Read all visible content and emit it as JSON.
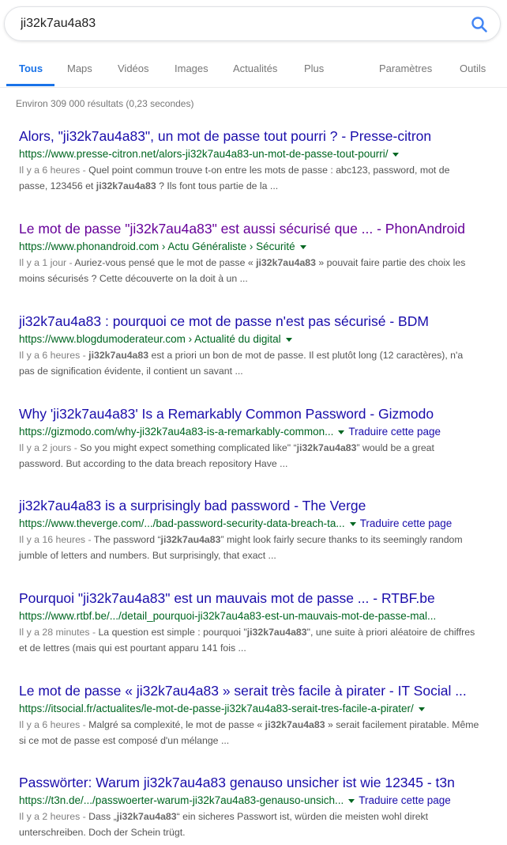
{
  "search": {
    "query": "ji32k7au4a83",
    "icon": "search-icon"
  },
  "tabs": [
    "Tous",
    "Maps",
    "Vidéos",
    "Images",
    "Actualités",
    "Plus"
  ],
  "tools": {
    "settings": "Paramètres",
    "tools": "Outils"
  },
  "stats": "Environ 309 000 résultats (0,23 secondes)",
  "colors": {
    "title": "#1a0dab",
    "visited": "#660099",
    "url": "#006621",
    "accent": "#1a73e8"
  },
  "results": [
    {
      "title": "Alors, \"ji32k7au4a83\", un mot de passe tout pourri ? - Presse-citron",
      "url": "https://www.presse-citron.net/alors-ji32k7au4a83-un-mot-de-passe-tout-pourri/",
      "date": "Il y a 6 heures - ",
      "snippet1_pre": "Quel point commun trouve t-on entre les mots de passe : abc123, password, mot de passe, 123456 et ",
      "snippet1_bold": "ji32k7au4a83",
      "snippet1_post": " ? Ils font tous partie de la ..."
    },
    {
      "title": "Le mot de passe \"ji32k7au4a83\" est aussi sécurisé que ... - PhonAndroid",
      "url": "https://www.phonandroid.com › Actu Généraliste › Sécurité",
      "date": "Il y a 1 jour - ",
      "snippet1_pre": "Auriez-vous pensé que le mot de passe « ",
      "snippet1_bold": "ji32k7au4a83",
      "snippet1_post": " » pouvait faire partie des choix les moins sécurisés ? Cette découverte on la doit à un ..."
    },
    {
      "title": "ji32k7au4a83 : pourquoi ce mot de passe n'est pas sécurisé - BDM",
      "url": "https://www.blogdumoderateur.com › Actualité du digital",
      "date": "Il y a 6 heures - ",
      "snippet1_pre": "",
      "snippet1_bold": "ji32k7au4a83",
      "snippet1_post": " est a priori un bon de mot de passe. Il est plutôt long (12 caractères), n'a pas de signification évidente, il contient un savant ..."
    },
    {
      "title": "Why 'ji32k7au4a83' Is a Remarkably Common Password - Gizmodo",
      "url": "https://gizmodo.com/why-ji32k7au4a83-is-a-remarkably-common...",
      "translate": "Traduire cette page",
      "date": "Il y a 2 jours - ",
      "snippet1_pre": "So you might expect something complicated like\" “",
      "snippet1_bold": "ji32k7au4a83",
      "snippet1_post": "” would be a great password. But according to the data breach repository Have ..."
    },
    {
      "title": "ji32k7au4a83 is a surprisingly bad password - The Verge",
      "url": "https://www.theverge.com/.../bad-password-security-data-breach-ta...",
      "translate": "Traduire cette page",
      "date": "Il y a 16 heures - ",
      "snippet1_pre": "The password “",
      "snippet1_bold": "ji32k7au4a83",
      "snippet1_post": "” might look fairly secure thanks to its seemingly random jumble of letters and numbers. But surprisingly, that exact ..."
    },
    {
      "title": "Pourquoi \"ji32k7au4a83\" est un mauvais mot de passe ... - RTBF.be",
      "url": "https://www.rtbf.be/.../detail_pourquoi-ji32k7au4a83-est-un-mauvais-mot-de-passe-mal...",
      "date": "Il y a 28 minutes - ",
      "snippet1_pre": "La question est simple : pourquoi \"",
      "snippet1_bold": "ji32k7au4a83",
      "snippet1_post": "\", une suite à priori aléatoire de chiffres et de lettres (mais qui est pourtant apparu 141 fois ..."
    },
    {
      "title": "Le mot de passe « ji32k7au4a83 » serait très facile à pirater - IT Social ...",
      "url": "https://itsocial.fr/actualites/le-mot-de-passe-ji32k7au4a83-serait-tres-facile-a-pirater/",
      "date": "Il y a 6 heures - ",
      "snippet1_pre": "Malgré sa complexité, le mot de passe « ",
      "snippet1_bold": "ji32k7au4a83",
      "snippet1_post": " » serait facilement piratable. Même si ce mot de passe est composé d'un mélange ..."
    },
    {
      "title": "Passwörter: Warum ji32k7au4a83 genauso unsicher ist wie 12345 - t3n",
      "url": "https://t3n.de/.../passwoerter-warum-ji32k7au4a83-genauso-unsich...",
      "translate": "Traduire cette page",
      "date": "Il y a 2 heures - ",
      "snippet1_pre": "Dass „",
      "snippet1_bold": "ji32k7au4a83",
      "snippet1_post": "“ ein sicheres Passwort ist, würden die meisten wohl direkt unterschreiben. Doch der Schein trügt."
    }
  ]
}
